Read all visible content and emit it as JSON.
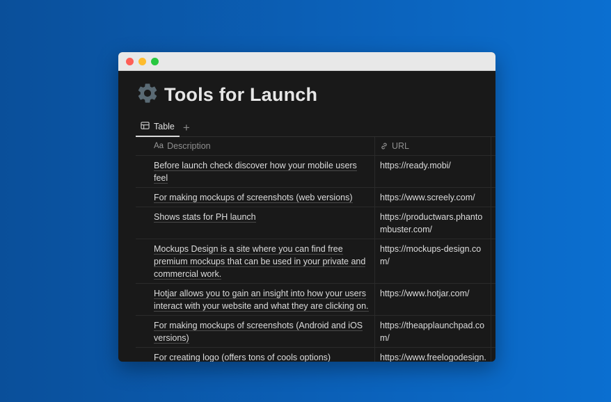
{
  "page": {
    "title": "Tools for Launch",
    "icon": "gear-icon"
  },
  "tabs": {
    "active_label": "Table",
    "add_label": "+"
  },
  "table": {
    "columns": {
      "description": "Description",
      "description_icon": "Aa",
      "url": "URL"
    },
    "rows": [
      {
        "description": "Before launch check discover how your mobile users feel",
        "url": "https://ready.mobi/"
      },
      {
        "description": "For making mockups of screenshots (web versions)",
        "url": "https://www.screely.com/"
      },
      {
        "description": "Shows stats for PH launch",
        "url": "https://productwars.phantombuster.com/"
      },
      {
        "description": "Mockups Design is a site where you can find free premium mockups that can be used in your private and commercial work.",
        "url": "https://mockups-design.com/"
      },
      {
        "description": "Hotjar allows you to gain an insight into how your users interact with your website and what they are clicking on.",
        "url": "https://www.hotjar.com/"
      },
      {
        "description": "For making mockups of screenshots (Android and iOS versions)",
        "url": "https://theapplaunchpad.com/"
      },
      {
        "description": "For creating logo (offers tons of cools options)",
        "url": "https://www.freelogodesign.org/"
      }
    ]
  },
  "colors": {
    "background": "#0b62bb",
    "window": "#191919",
    "titlebar": "#e8e8e8",
    "text": "#dcdcdc"
  }
}
